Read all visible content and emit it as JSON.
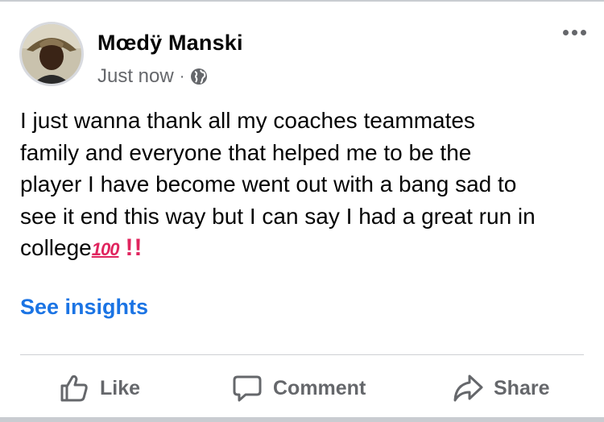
{
  "post": {
    "author": "Mœdÿ Manski",
    "timestamp": "Just now",
    "separator": "·",
    "audience_icon": "globe-icon",
    "text": "I just wanna thank all my coaches teammates\nfamily and everyone that helped me to be the\nplayer I have become went out with a bang sad to\nsee it end this way but I can say I had a great run in\ncollege",
    "emoji_hundred": "100",
    "emoji_bang": "!!",
    "insights_label": "See insights"
  },
  "actions": {
    "like_label": "Like",
    "comment_label": "Comment",
    "share_label": "Share"
  },
  "colors": {
    "link_blue": "#1b74e4",
    "secondary_text": "#65676b",
    "emoji_red": "#e0245e",
    "divider": "#ced0d4"
  }
}
